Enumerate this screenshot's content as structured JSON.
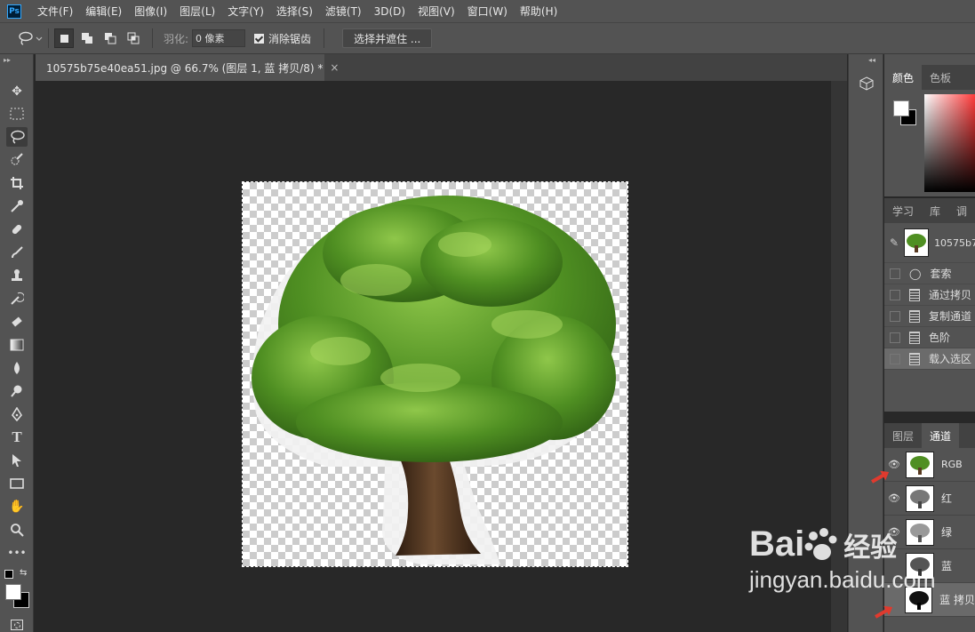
{
  "app": {
    "logo_text": "Ps"
  },
  "menu": [
    "文件(F)",
    "编辑(E)",
    "图像(I)",
    "图层(L)",
    "文字(Y)",
    "选择(S)",
    "滤镜(T)",
    "3D(D)",
    "视图(V)",
    "窗口(W)",
    "帮助(H)"
  ],
  "options": {
    "feather_label": "羽化:",
    "feather_value": "0 像素",
    "antialias_label": "消除锯齿",
    "select_mask_label": "选择并遮住 ..."
  },
  "document": {
    "tab_title": "10575b75e40ea51.jpg @ 66.7% (图层 1, 蓝 拷贝/8) *",
    "close_glyph": "×"
  },
  "color_panel": {
    "tabs": [
      "颜色",
      "色板"
    ]
  },
  "history_panel": {
    "tabs": [
      "学习",
      "库",
      "调"
    ],
    "snapshot_name": "10575b7",
    "items": [
      "套索",
      "通过拷贝",
      "复制通道",
      "色阶",
      "载入选区"
    ]
  },
  "channels_panel": {
    "tabs": [
      "图层",
      "通道"
    ],
    "items": [
      {
        "name": "RGB",
        "visible": true
      },
      {
        "name": "红",
        "visible": true
      },
      {
        "name": "绿",
        "visible": true
      },
      {
        "name": "蓝",
        "visible": false
      },
      {
        "name": "蓝 拷贝",
        "visible": false
      }
    ]
  },
  "watermark": {
    "brand": "Bai",
    "brand_cn": "经验",
    "url": "jingyan.baidu.com"
  },
  "colors": {
    "accent_red": "#e03a2e",
    "foliage": "#4f8f22",
    "trunk": "#5a3b22"
  }
}
